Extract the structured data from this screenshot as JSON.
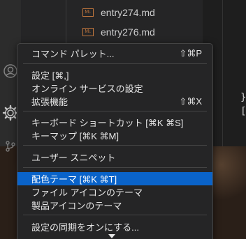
{
  "explorer": {
    "files": [
      {
        "icon": "M↓",
        "name": "entry274.md"
      },
      {
        "icon": "M↓",
        "name": "entry276.md"
      }
    ]
  },
  "editor": {
    "visible_chars": [
      "}",
      "["
    ]
  },
  "activity_bar": {
    "icons": [
      "account-icon",
      "settings-gear-icon",
      "source-control-icon"
    ]
  },
  "menu": {
    "items": [
      {
        "label": "コマンド パレット...",
        "shortcut": "⇧⌘P"
      },
      {
        "label": "設定 [⌘,]",
        "shortcut": ""
      },
      {
        "label": "オンライン サービスの設定",
        "shortcut": ""
      },
      {
        "label": "拡張機能",
        "shortcut": "⇧⌘X"
      },
      {
        "label": "キーボード ショートカット [⌘K ⌘S]",
        "shortcut": ""
      },
      {
        "label": "キーマップ [⌘K ⌘M]",
        "shortcut": ""
      },
      {
        "label": "ユーザー スニペット",
        "shortcut": ""
      },
      {
        "label": "配色テーマ [⌘K ⌘T]",
        "shortcut": ""
      },
      {
        "label": "ファイル アイコンのテーマ",
        "shortcut": ""
      },
      {
        "label": "製品アイコンのテーマ",
        "shortcut": ""
      },
      {
        "label": "設定の同期をオンにする...",
        "shortcut": ""
      }
    ],
    "selected_index": 7
  }
}
